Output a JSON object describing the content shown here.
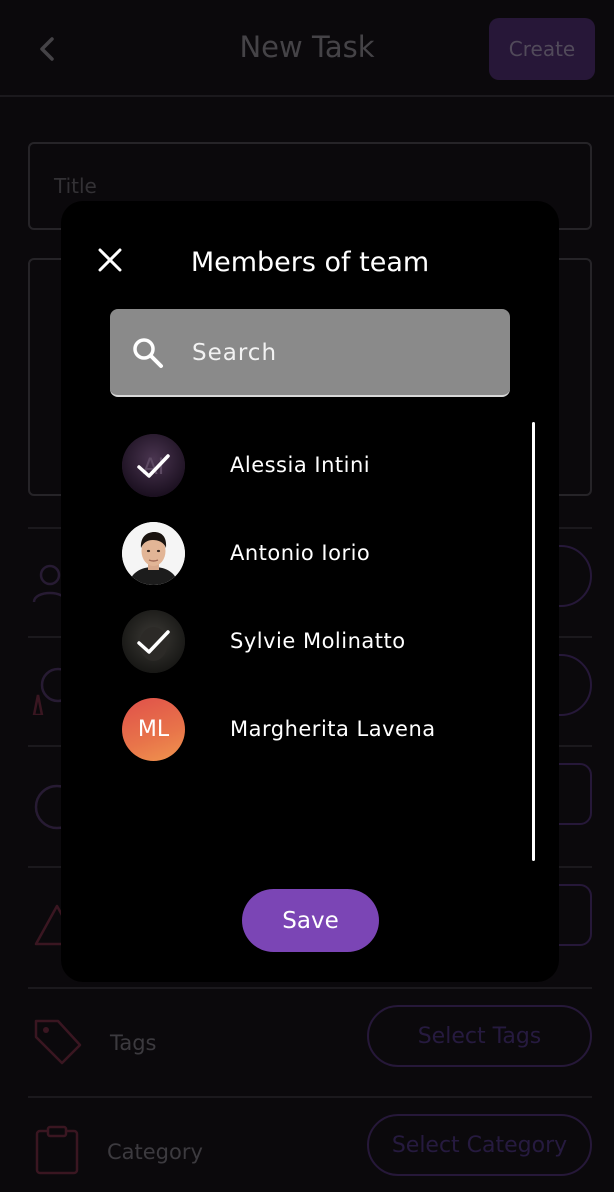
{
  "header": {
    "title": "New Task",
    "create_label": "Create"
  },
  "form": {
    "title_placeholder": "Title"
  },
  "rows": {
    "tags_label": "Tags",
    "tags_button": "Select Tags",
    "category_label": "Category",
    "category_button": "Select Category"
  },
  "modal": {
    "title": "Members of team",
    "search_placeholder": "Search",
    "save_label": "Save",
    "members": [
      {
        "name": "Alessia Intini",
        "selected": true
      },
      {
        "name": "Antonio Iorio",
        "selected": false
      },
      {
        "name": "Sylvie Molinatto",
        "selected": true
      },
      {
        "name": "Margherita Lavena",
        "initials": "ML",
        "selected": false
      }
    ]
  },
  "colors": {
    "accent": "#7b45b5",
    "background": "#110f13",
    "modal": "#000000",
    "search_bg": "#8a8a8a"
  }
}
